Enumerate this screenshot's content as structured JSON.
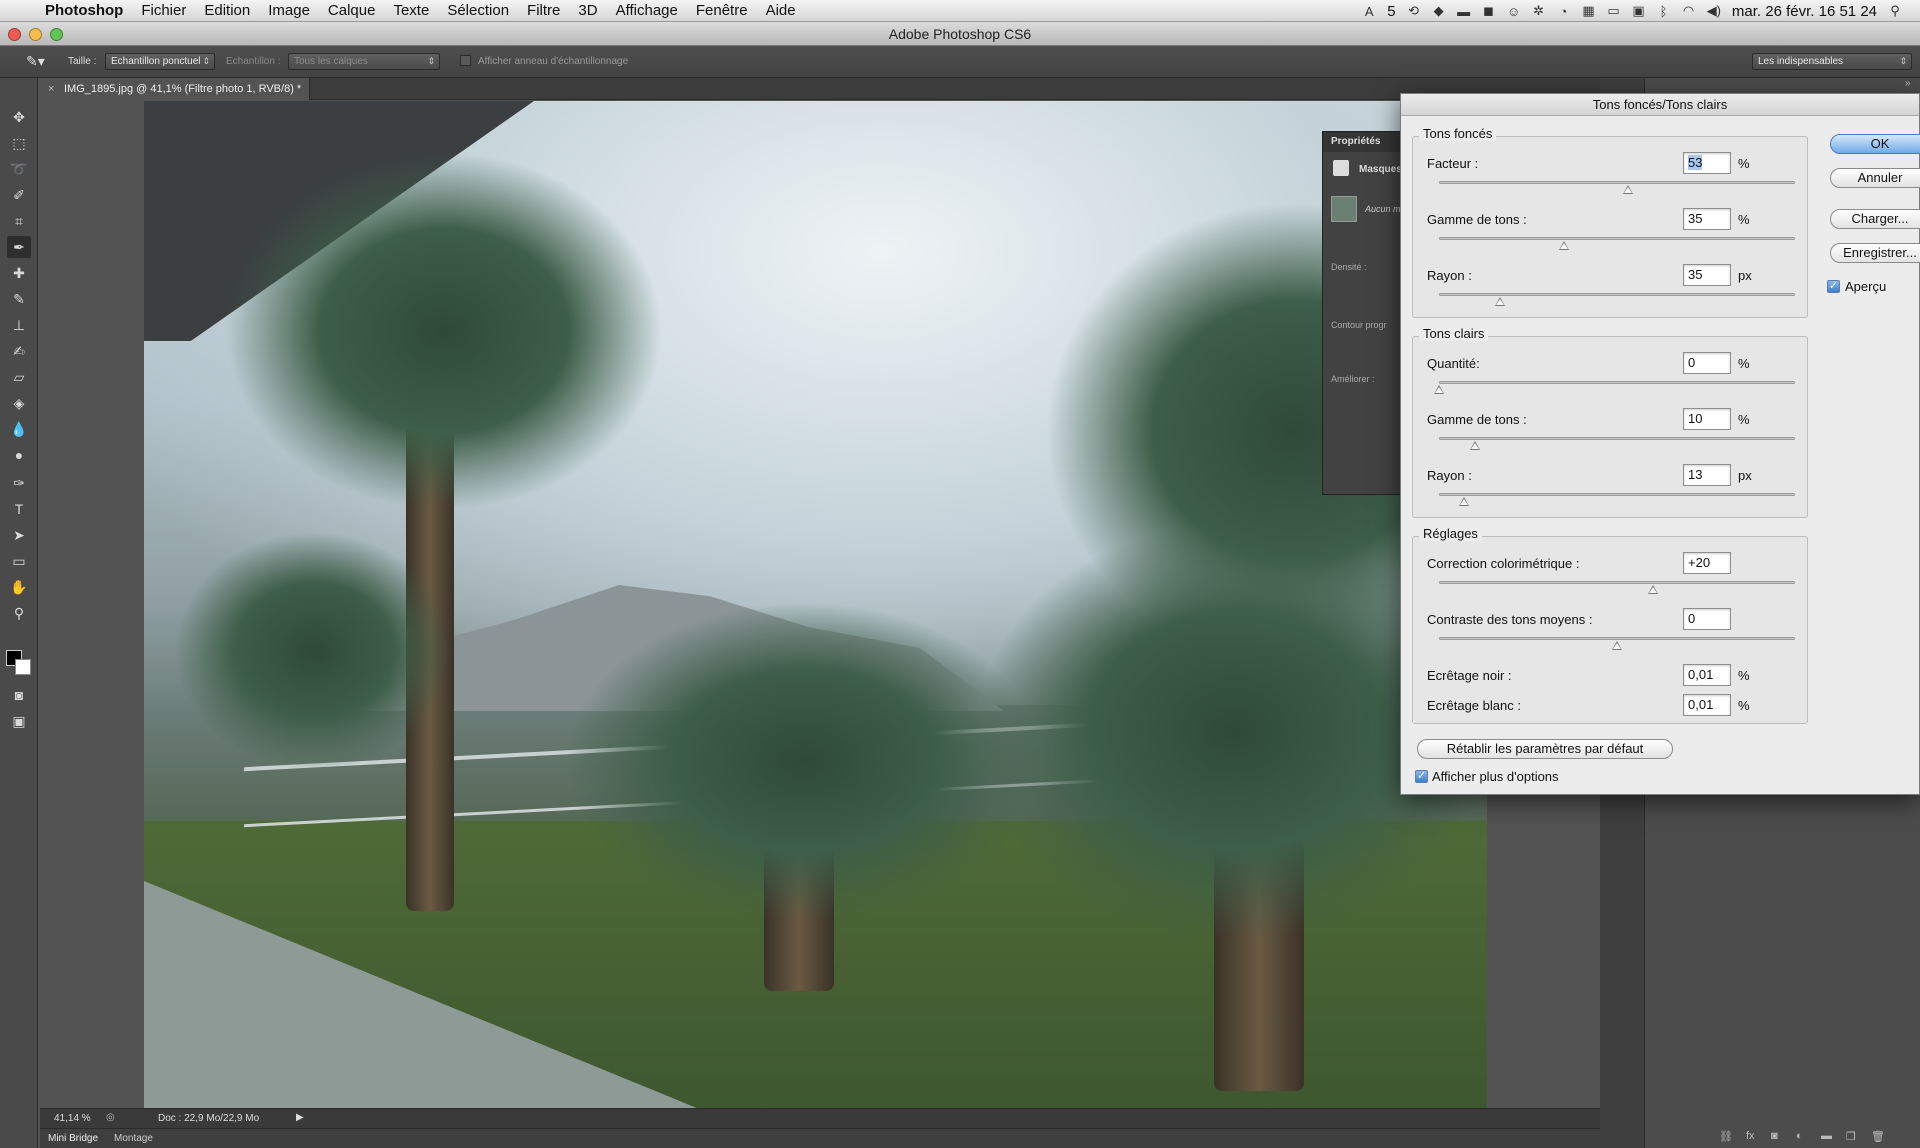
{
  "menubar": {
    "app_name": "Photoshop",
    "items": [
      "Fichier",
      "Edition",
      "Image",
      "Calque",
      "Texte",
      "Sélection",
      "Filtre",
      "3D",
      "Affichage",
      "Fenêtre",
      "Aide"
    ],
    "status_badge": "5",
    "clock": "mar. 26 févr.  16 51 24"
  },
  "window": {
    "title": "Adobe Photoshop CS6"
  },
  "options_bar": {
    "size_label": "Taille :",
    "size_value": "Echantillon ponctuel",
    "sample_label": "Echantillon :",
    "sample_value": "Tous les calques",
    "ring_label": "Afficher anneau d'échantillonnage",
    "workspace": "Les indispensables"
  },
  "document": {
    "tab_title": "IMG_1895.jpg @ 41,1% (Filtre photo 1, RVB/8) *",
    "zoom": "41,14 %",
    "doc_size": "Doc : 22,9 Mo/22,9 Mo"
  },
  "bottom_tabs": {
    "mini_bridge": "Mini Bridge",
    "montage": "Montage"
  },
  "properties_panel": {
    "title": "Propriétés",
    "masks": "Masques",
    "no_mask": "Aucun m",
    "density": "Densité :",
    "feather": "Contour progr",
    "refine": "Améliorer :"
  },
  "dialog": {
    "title": "Tons foncés/Tons clairs",
    "shadows": {
      "label": "Tons foncés",
      "amount": {
        "label": "Facteur :",
        "value": "53",
        "unit": "%",
        "slider": 0.53
      },
      "tonal": {
        "label": "Gamme de tons :",
        "value": "35",
        "unit": "%",
        "slider": 0.35
      },
      "radius": {
        "label": "Rayon :",
        "value": "35",
        "unit": "px",
        "slider": 0.17
      }
    },
    "highlights": {
      "label": "Tons clairs",
      "amount": {
        "label": "Quantité:",
        "value": "0",
        "unit": "%",
        "slider": 0.0
      },
      "tonal": {
        "label": "Gamme de tons :",
        "value": "10",
        "unit": "%",
        "slider": 0.1
      },
      "radius": {
        "label": "Rayon :",
        "value": "13",
        "unit": "px",
        "slider": 0.07
      }
    },
    "adjust": {
      "label": "Réglages",
      "color": {
        "label": "Correction colorimétrique :",
        "value": "+20",
        "slider": 0.6
      },
      "midtone": {
        "label": "Contraste des tons moyens :",
        "value": "0",
        "slider": 0.5
      },
      "black_clip": {
        "label": "Ecrêtage noir :",
        "value": "0,01",
        "unit": "%"
      },
      "white_clip": {
        "label": "Ecrêtage blanc :",
        "value": "0,01",
        "unit": "%"
      }
    },
    "buttons": {
      "ok": "OK",
      "cancel": "Annuler",
      "load": "Charger...",
      "save": "Enregistrer...",
      "preview": "Aperçu",
      "reset": "Rétablir les paramètres par défaut",
      "more_options": "Afficher plus d'options"
    }
  }
}
